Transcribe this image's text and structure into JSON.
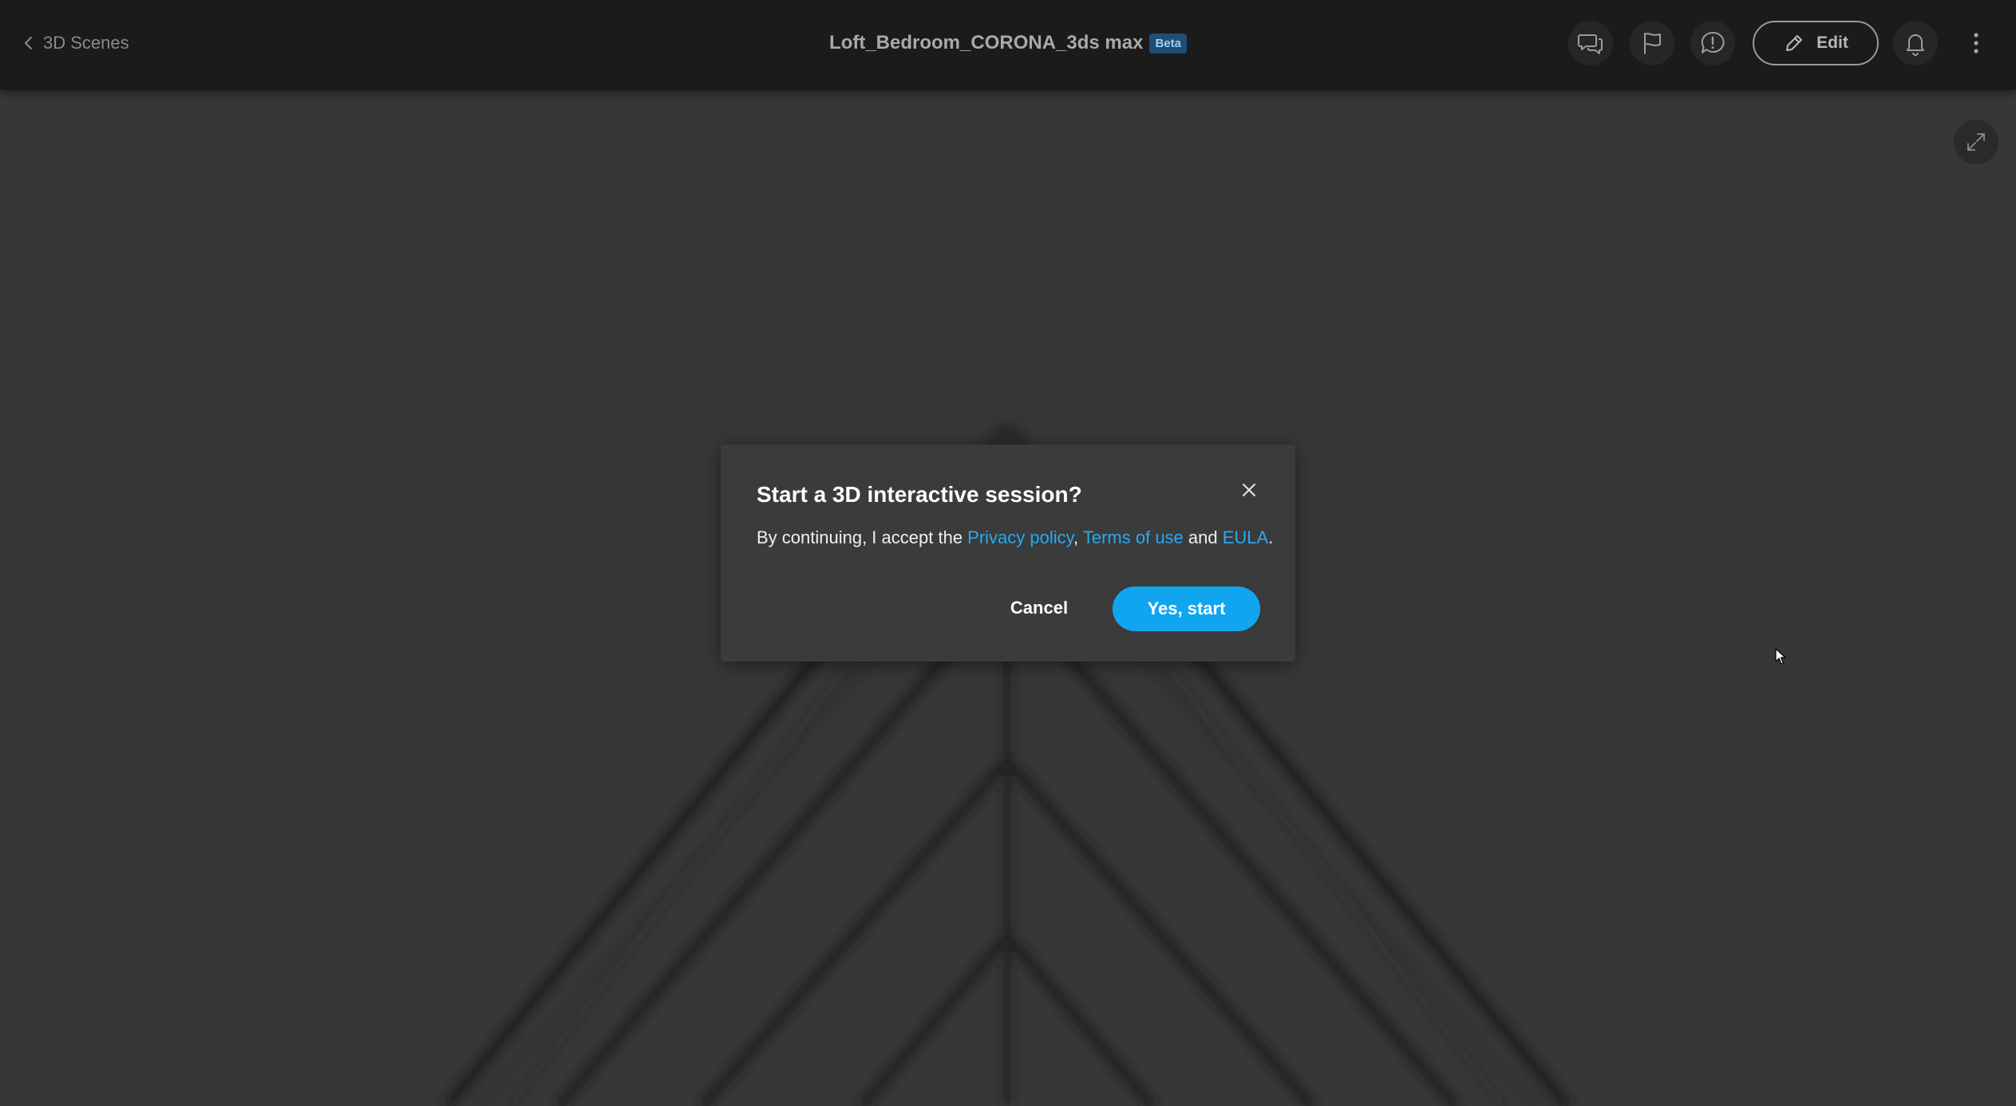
{
  "header": {
    "back_label": "3D Scenes",
    "title": "Loft_Bedroom_CORONA_3ds max",
    "badge": "Beta",
    "edit_label": "Edit",
    "icons": [
      "chat-icon",
      "flag-icon",
      "alert-icon",
      "pencil-icon",
      "bell-icon",
      "more-vertical-icon"
    ]
  },
  "viewport": {
    "fullscreen_icon": "expand-icon"
  },
  "dialog": {
    "title": "Start a 3D interactive session?",
    "body_prefix": "By continuing, I accept the ",
    "link_privacy": "Privacy policy",
    "sep_comma": ", ",
    "link_terms": "Terms of use",
    "sep_and": " and ",
    "link_eula": "EULA",
    "suffix": ".",
    "cancel_label": "Cancel",
    "confirm_label": "Yes, start"
  },
  "colors": {
    "accent": "#10a6ef",
    "link": "#29a8f0",
    "topbar": "#1b1b1b",
    "dialog": "#3b3b3b",
    "badge_bg": "#1d4f78"
  }
}
